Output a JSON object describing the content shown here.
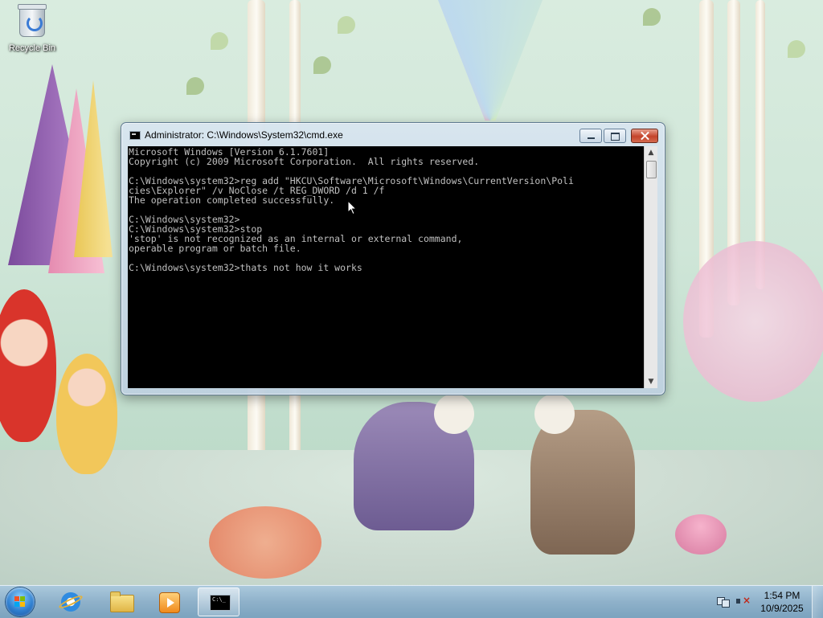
{
  "desktop": {
    "icons": [
      {
        "label": "Recycle Bin",
        "icon": "recycle-bin-icon"
      }
    ]
  },
  "window": {
    "title": "Administrator: C:\\Windows\\System32\\cmd.exe",
    "icon": "cmd-icon",
    "console_lines": [
      "Microsoft Windows [Version 6.1.7601]",
      "Copyright (c) 2009 Microsoft Corporation.  All rights reserved.",
      "",
      "C:\\Windows\\system32>reg add \"HKCU\\Software\\Microsoft\\Windows\\CurrentVersion\\Poli",
      "cies\\Explorer\" /v NoClose /t REG_DWORD /d 1 /f",
      "The operation completed successfully.",
      "",
      "C:\\Windows\\system32>",
      "C:\\Windows\\system32>stop",
      "'stop' is not recognized as an internal or external command,",
      "operable program or batch file.",
      "",
      "C:\\Windows\\system32>thats not how it works"
    ]
  },
  "taskbar": {
    "start_icon": "windows-start-icon",
    "pinned": [
      {
        "name": "internet-explorer-icon"
      },
      {
        "name": "file-explorer-icon"
      },
      {
        "name": "media-player-icon"
      },
      {
        "name": "cmd-icon",
        "active": true
      }
    ],
    "tray": {
      "network_icon": "network-icon",
      "volume_icon": "volume-muted-icon",
      "time": "1:54 PM",
      "date": "10/9/2025"
    }
  }
}
